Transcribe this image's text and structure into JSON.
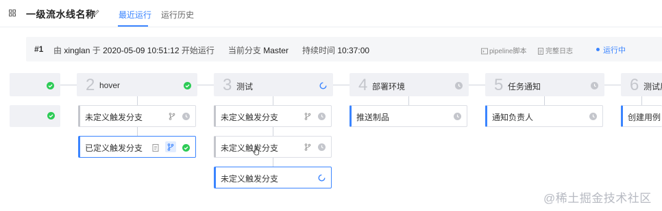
{
  "header": {
    "title": "一级流水线名称",
    "tabs": [
      {
        "label": "最近运行",
        "active": true
      },
      {
        "label": "运行历史",
        "active": false
      }
    ]
  },
  "run": {
    "number": "#1",
    "by": "由",
    "user": "xinglan",
    "at": "于",
    "datetime": "2020-05-09 10:51:12",
    "start": "开始运行",
    "branch_label": "当前分支",
    "branch": "Master",
    "duration_label": "持续时间",
    "duration": "10:37:00",
    "links": {
      "script": "pipeline脚本",
      "log": "完整日志"
    },
    "status": "运行中"
  },
  "stages": [
    {
      "num": "",
      "name": "",
      "status": "success"
    },
    {
      "num": "2",
      "name": "hover",
      "status": "success"
    },
    {
      "num": "3",
      "name": "测试",
      "status": "running"
    },
    {
      "num": "4",
      "name": "部署环境",
      "status": "pending"
    },
    {
      "num": "5",
      "name": "任务通知",
      "status": "pending"
    },
    {
      "num": "6",
      "name": "测试用",
      "status": "pending"
    }
  ],
  "jobs": {
    "s1": [
      {
        "name": "",
        "status": "success"
      }
    ],
    "s2": [
      {
        "name": "未定义触发分支",
        "status": "pending"
      },
      {
        "name": "已定义触发分支",
        "status": "success"
      }
    ],
    "s3": [
      {
        "name": "未定义触发分支",
        "status": "pending"
      },
      {
        "name": "未定义触发分支",
        "status": "pending"
      },
      {
        "name": "未定义触发分支",
        "status": "running"
      }
    ],
    "s4": [
      {
        "name": "推送制品",
        "status": "pending"
      }
    ],
    "s5": [
      {
        "name": "通知负责人",
        "status": "pending"
      }
    ],
    "s6": [
      {
        "name": "创建用例",
        "status": "pending"
      }
    ]
  },
  "watermark": "@稀土掘金技术社区",
  "colors": {
    "accent": "#3a84ff",
    "success": "#2dcb56",
    "pending": "#c4c6cc"
  }
}
